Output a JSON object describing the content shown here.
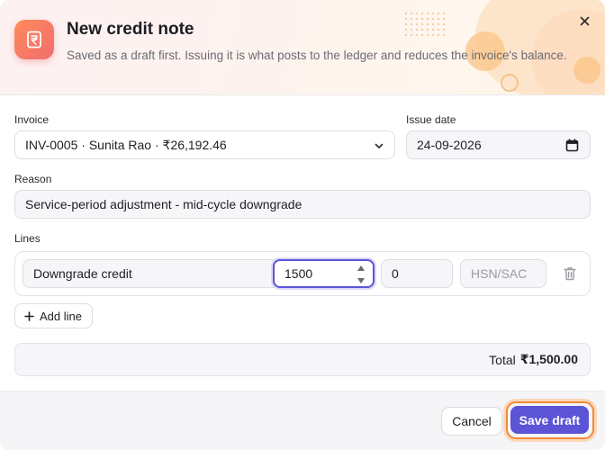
{
  "dialog": {
    "title": "New credit note",
    "subtitle": "Saved as a draft first. Issuing it is what posts to the ledger and reduces the invoice's balance.",
    "close_icon": "close-icon",
    "app_icon": "rupee-document-icon"
  },
  "form": {
    "invoice": {
      "label": "Invoice",
      "value": "INV-0005 · Sunita Rao · ₹26,192.46"
    },
    "issue_date": {
      "label": "Issue date",
      "value": "24-09-2026"
    },
    "reason": {
      "label": "Reason",
      "value": "Service-period adjustment - mid-cycle downgrade"
    },
    "lines": {
      "label": "Lines",
      "items": [
        {
          "description": "Downgrade credit",
          "quantity": "1500",
          "rate": "0",
          "hsn_placeholder": "HSN/SAC"
        }
      ],
      "add_line_label": "Add line"
    },
    "total": {
      "label": "Total",
      "amount": "₹1,500.00"
    }
  },
  "footer": {
    "cancel_label": "Cancel",
    "save_label": "Save draft"
  },
  "colors": {
    "accent": "#5b54d6",
    "focus_ring": "#f08a3c",
    "icon_gradient_start": "#ff8a5c",
    "icon_gradient_end": "#f26d6d"
  }
}
